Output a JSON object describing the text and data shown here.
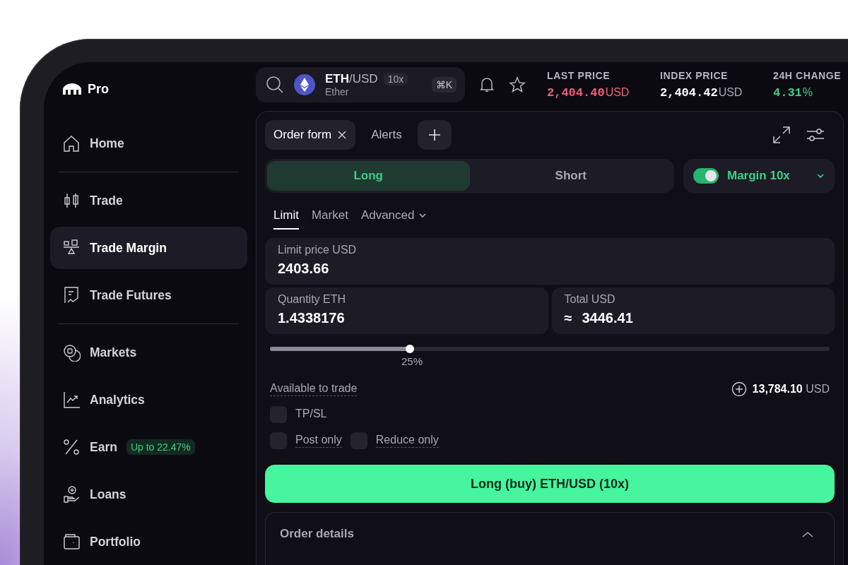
{
  "sidebar": {
    "logo_text": "Pro",
    "groups": [
      [
        {
          "label": "Home",
          "kind": "home",
          "selected": false
        }
      ],
      [
        {
          "label": "Trade",
          "kind": "candles",
          "selected": false
        },
        {
          "label": "Trade Margin",
          "kind": "scale",
          "selected": true
        },
        {
          "label": "Trade Futures",
          "kind": "futures",
          "selected": false
        }
      ],
      [
        {
          "label": "Markets",
          "kind": "coins",
          "selected": false
        },
        {
          "label": "Analytics",
          "kind": "chart",
          "selected": false
        },
        {
          "label": "Earn",
          "kind": "percent",
          "selected": false,
          "badge": "Up to 22.47%"
        },
        {
          "label": "Loans",
          "kind": "loan",
          "selected": false
        },
        {
          "label": "Portfolio",
          "kind": "wallet",
          "selected": false
        }
      ]
    ]
  },
  "search": {
    "base": "ETH",
    "quote": "/USD",
    "leverage": "10x",
    "name": "Ether",
    "shortcut": "⌘K"
  },
  "tickers": [
    {
      "label": "LAST PRICE",
      "value": "2,404.40",
      "unit": "USD",
      "color": "#f0607a",
      "unit_muted": false
    },
    {
      "label": "INDEX PRICE",
      "value": "2,404.42",
      "unit": "USD",
      "color": "#ffffff",
      "unit_muted": true
    },
    {
      "label": "24H CHANGE",
      "value": "4.31",
      "unit": "%",
      "color": "#3ecf84",
      "unit_muted": false
    }
  ],
  "panel_tabs": [
    {
      "label": "Order form",
      "closable": true,
      "selected": true
    },
    {
      "label": "Alerts",
      "closable": false,
      "selected": false
    }
  ],
  "sides": [
    {
      "label": "Long",
      "selected": true
    },
    {
      "label": "Short",
      "selected": false
    }
  ],
  "margin": {
    "on": true,
    "label": "Margin 10x"
  },
  "order_types": [
    {
      "label": "Limit",
      "selected": true,
      "dropdown": false
    },
    {
      "label": "Market",
      "selected": false,
      "dropdown": false
    },
    {
      "label": "Advanced",
      "selected": false,
      "dropdown": true
    }
  ],
  "limit_price": {
    "label": "Limit price USD",
    "value": "2403.66"
  },
  "quantity": {
    "label": "Quantity ETH",
    "value": "1.4338176"
  },
  "total": {
    "label": "Total USD",
    "prefix": "≈",
    "value": "3446.41"
  },
  "slider": {
    "level": 0.25,
    "reading": "25%"
  },
  "available": {
    "label": "Available to trade",
    "amount": "13,784.10",
    "unit": "USD"
  },
  "option_rows": [
    [
      {
        "label": "TP/SL",
        "checked": false,
        "hint": false
      }
    ],
    [
      {
        "label": "Post only",
        "checked": false,
        "hint": true
      },
      {
        "label": "Reduce only",
        "checked": false,
        "hint": true
      }
    ]
  ],
  "submit_button": "Long (buy) ETH/USD (10x)",
  "order_details": {
    "title": "Order details",
    "expanded": true
  }
}
